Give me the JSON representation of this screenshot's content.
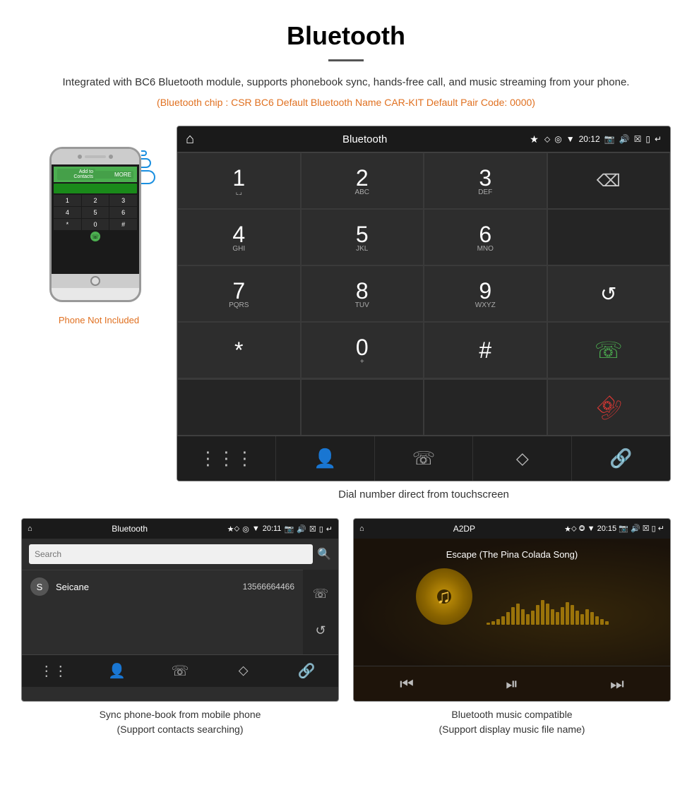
{
  "header": {
    "title": "Bluetooth",
    "description": "Integrated with BC6 Bluetooth module, supports phonebook sync, hands-free call, and music streaming from your phone.",
    "specs": "(Bluetooth chip : CSR BC6    Default Bluetooth Name CAR-KIT    Default Pair Code: 0000)"
  },
  "phone_note": "Phone Not Included",
  "dial_screen": {
    "status_bar": {
      "app_name": "Bluetooth",
      "time": "20:12"
    },
    "keys": [
      {
        "main": "1",
        "sub": "⌞⌟"
      },
      {
        "main": "2",
        "sub": "ABC"
      },
      {
        "main": "3",
        "sub": "DEF"
      },
      {
        "main": "",
        "sub": ""
      },
      {
        "main": "4",
        "sub": "GHI"
      },
      {
        "main": "5",
        "sub": "JKL"
      },
      {
        "main": "6",
        "sub": "MNO"
      },
      {
        "main": "",
        "sub": ""
      },
      {
        "main": "7",
        "sub": "PQRS"
      },
      {
        "main": "8",
        "sub": "TUV"
      },
      {
        "main": "9",
        "sub": "WXYZ"
      },
      {
        "main": "↺",
        "sub": ""
      },
      {
        "main": "*",
        "sub": ""
      },
      {
        "main": "0",
        "sub": "+"
      },
      {
        "main": "#",
        "sub": ""
      },
      {
        "main": "📞",
        "sub": ""
      },
      {
        "main": "📵",
        "sub": ""
      }
    ],
    "caption": "Dial number direct from touchscreen"
  },
  "phonebook_screen": {
    "status_bar": {
      "app_name": "Bluetooth",
      "time": "20:11"
    },
    "search_placeholder": "Search",
    "contacts": [
      {
        "letter": "S",
        "name": "Seicane",
        "phone": "13566664466"
      }
    ],
    "caption": "Sync phone-book from mobile phone\n(Support contacts searching)"
  },
  "music_screen": {
    "status_bar": {
      "app_name": "A2DP",
      "time": "20:15"
    },
    "song_title": "Escape (The Pina Colada Song)",
    "caption": "Bluetooth music compatible\n(Support display music file name)"
  },
  "viz_bars": [
    3,
    5,
    8,
    12,
    18,
    25,
    30,
    22,
    15,
    20,
    28,
    35,
    30,
    22,
    18,
    25,
    32,
    28,
    20,
    15,
    22,
    18,
    12,
    8,
    5
  ]
}
